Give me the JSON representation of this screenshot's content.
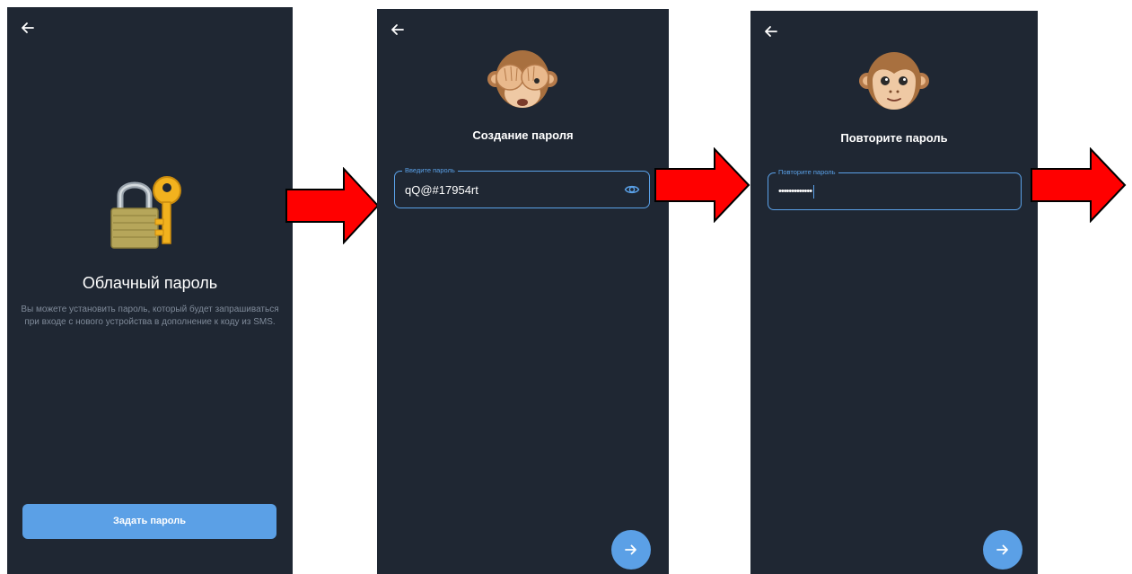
{
  "screen1": {
    "title": "Облачный пароль",
    "description": "Вы можете установить пароль, который будет запрашиваться при входе с нового устройства в дополнение к коду из SMS.",
    "set_password_button": "Задать пароль",
    "back_icon": "arrow-left-icon",
    "illustration_icon": "lock-with-key-icon"
  },
  "screen2": {
    "title": "Создание пароля",
    "field_label": "Введите пароль",
    "field_value": "qQ@#17954rt",
    "eye_icon": "eye-icon",
    "next_icon": "arrow-right-icon",
    "illustration_icon": "see-no-evil-monkey-icon"
  },
  "screen3": {
    "title": "Повторите пароль",
    "field_label": "Повторите пароль",
    "field_value": "•••••••••••••",
    "next_icon": "arrow-right-icon",
    "illustration_icon": "monkey-face-icon"
  },
  "colors": {
    "background": "#1f2733",
    "accent": "#5ba0e6",
    "muted_text": "#7f8a99",
    "flow_arrow": "#ff0000"
  }
}
